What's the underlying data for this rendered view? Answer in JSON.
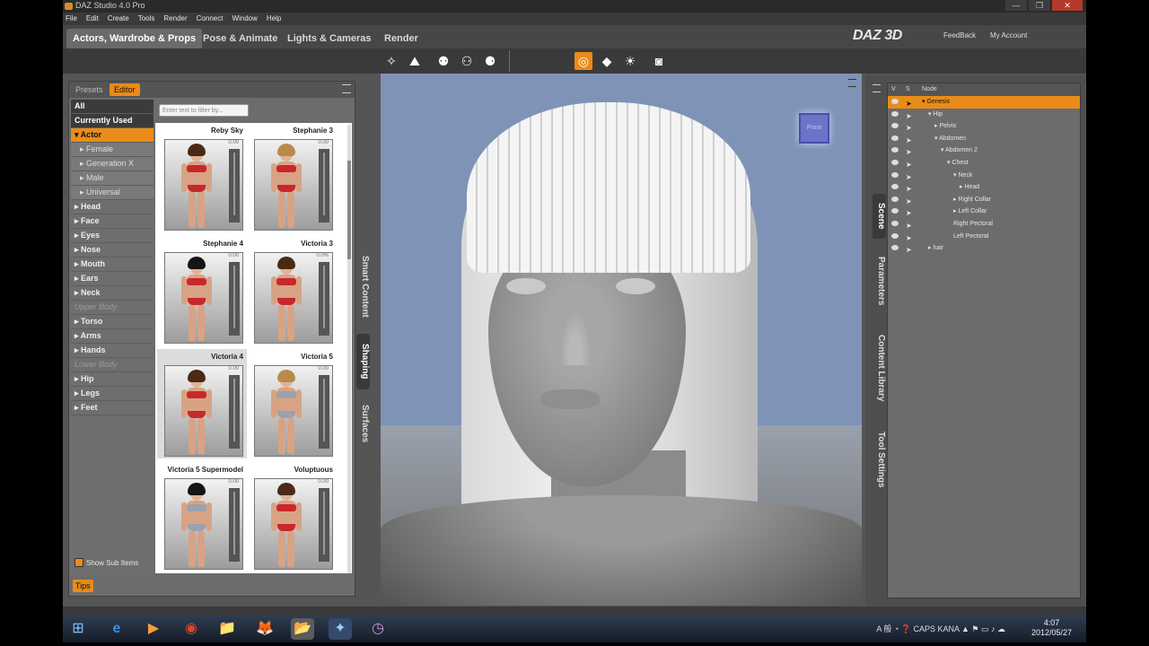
{
  "window": {
    "title": "DAZ Studio 4.0 Pro",
    "controls": [
      "—",
      "❐",
      "✕"
    ]
  },
  "menu": [
    "File",
    "Edit",
    "Create",
    "Tools",
    "Render",
    "Connect",
    "Window",
    "Help"
  ],
  "rooms": [
    "Actors, Wardrobe & Props",
    "Pose & Animate",
    "Lights & Cameras",
    "Render"
  ],
  "brand": {
    "logo": "DAZ 3D",
    "links": [
      "FeedBack",
      "My Account"
    ],
    "accent": "#e98c19"
  },
  "toolbar_icons": [
    "node-selection-icon",
    "universal-tool-icon",
    "figure-pose-icon",
    "active-pose-icon",
    "joint-editor-icon",
    "surface-selection-icon",
    "geometry-editor-icon",
    "light-tool-icon",
    "camera-render-icon"
  ],
  "leftpane": {
    "tabs": [
      "Presets",
      "Editor"
    ],
    "filter_placeholder": "Enter text to filter by...",
    "categories": [
      {
        "label": "All",
        "style": "dark"
      },
      {
        "label": "Currently Used",
        "style": "dark"
      },
      {
        "label": "▾ Actor",
        "style": "sel"
      },
      {
        "label": "▸ Female",
        "style": "sub"
      },
      {
        "label": "▸ Generation X",
        "style": "sub"
      },
      {
        "label": "▸ Male",
        "style": "sub"
      },
      {
        "label": "▸ Universal",
        "style": "sub"
      },
      {
        "label": "▸ Head",
        "style": ""
      },
      {
        "label": "▸ Face",
        "style": ""
      },
      {
        "label": "▸ Eyes",
        "style": ""
      },
      {
        "label": "▸ Nose",
        "style": ""
      },
      {
        "label": "▸ Mouth",
        "style": ""
      },
      {
        "label": "▸ Ears",
        "style": ""
      },
      {
        "label": "▸ Neck",
        "style": ""
      },
      {
        "label": "Upper Body",
        "style": "dim"
      },
      {
        "label": "▸ Torso",
        "style": ""
      },
      {
        "label": "▸ Arms",
        "style": ""
      },
      {
        "label": "▸ Hands",
        "style": ""
      },
      {
        "label": "Lower Body",
        "style": "dim"
      },
      {
        "label": "▸ Hip",
        "style": ""
      },
      {
        "label": "▸ Legs",
        "style": ""
      },
      {
        "label": "▸ Feet",
        "style": ""
      }
    ],
    "show_sub_items": "Show Sub Items",
    "tips": "Tips",
    "tiles": [
      {
        "name": "Reby Sky",
        "pct": "0.00",
        "hair": ""
      },
      {
        "name": "Stephanie 3",
        "pct": "0.00",
        "hair": "blonde"
      },
      {
        "name": "Stephanie 4",
        "pct": "0.00",
        "hair": "black"
      },
      {
        "name": "Victoria 3",
        "pct": "0.0%",
        "hair": ""
      },
      {
        "name": "Victoria 4",
        "pct": "0.00",
        "hair": "",
        "highlight": true
      },
      {
        "name": "Victoria 5",
        "pct": "0.00",
        "hair": "blonde silver"
      },
      {
        "name": "Victoria 5 Supermodel",
        "pct": "0.00",
        "hair": "black silver"
      },
      {
        "name": "Voluptuous",
        "pct": "0.00",
        "hair": ""
      }
    ]
  },
  "left_vtabs": [
    "Smart Content",
    "Shaping",
    "Surfaces"
  ],
  "right_vtabs": [
    "Scene",
    "Parameters",
    "Content Library",
    "Tool Settings"
  ],
  "viewport": {
    "cube_label": "Front"
  },
  "scene": {
    "columns": [
      "V",
      "S",
      "Node"
    ],
    "nodes": [
      {
        "label": "▾ Genesis",
        "indent": 0,
        "sel": true
      },
      {
        "label": "▾ Hip",
        "indent": 1
      },
      {
        "label": "▸ Pelvis",
        "indent": 2
      },
      {
        "label": "▾ Abdomen",
        "indent": 2
      },
      {
        "label": "▾ Abdomen 2",
        "indent": 3
      },
      {
        "label": "▾ Chest",
        "indent": 4
      },
      {
        "label": "▾ Neck",
        "indent": 5
      },
      {
        "label": "▸ Head",
        "indent": 6
      },
      {
        "label": "▸ Right Collar",
        "indent": 5
      },
      {
        "label": "▸ Left Collar",
        "indent": 5
      },
      {
        "label": "Right Pectoral",
        "indent": 5
      },
      {
        "label": "Left Pectoral",
        "indent": 5
      },
      {
        "label": "▸ hair",
        "indent": 1
      }
    ]
  },
  "taskbar": {
    "apps": [
      "⊞",
      "e",
      "▶",
      "◉",
      "📁",
      "🦊",
      "📂",
      "✦",
      "◷"
    ],
    "tray": "A 般 ◔ ❓ CAPS KANA ▲ ⚑ ▭ ♪ ☁",
    "time": "4:07",
    "date": "2012/05/27"
  }
}
